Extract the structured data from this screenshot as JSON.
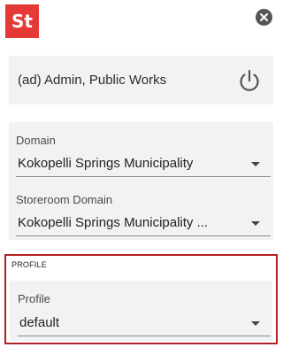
{
  "header": {
    "logo_text": "St",
    "close_icon": "close-circle-icon"
  },
  "user": {
    "name": "(ad) Admin, Public Works",
    "power_icon": "power-icon"
  },
  "domain": {
    "label": "Domain",
    "value": "Kokopelli Springs Municipality"
  },
  "storeroom_domain": {
    "label": "Storeroom Domain",
    "value": "Kokopelli Springs Municipality ..."
  },
  "profile": {
    "section_title": "PROFILE",
    "label": "Profile",
    "value": "default"
  },
  "colors": {
    "brand": "#e53935",
    "highlight_border": "#b22222",
    "card_bg": "#f2f2f5"
  }
}
